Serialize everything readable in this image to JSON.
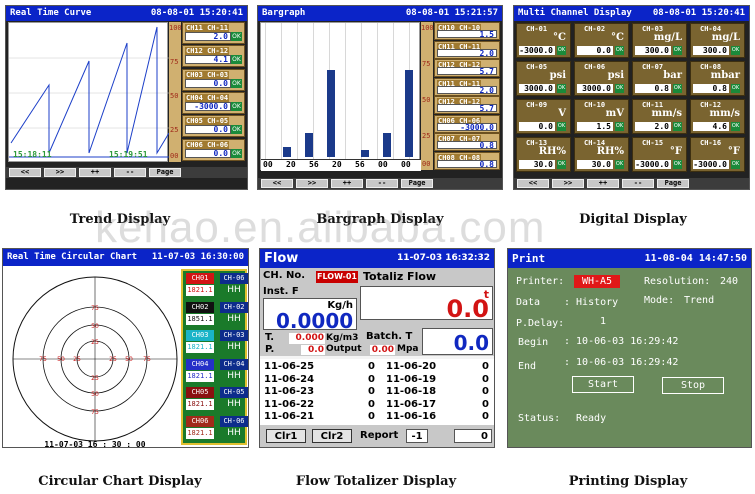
{
  "watermark": "kehao.en.alibaba.com",
  "colors": {
    "title_blue": "#0b24c8",
    "yellow_panel": "#d0b070",
    "green_bg": "#6a8a5c",
    "ok_green": "#1a8a3a"
  },
  "captions": [
    "Trend Display",
    "Bargraph Display",
    "Digital Display",
    "Circular Chart Display",
    "Flow Totalizer Display",
    "Printing Display"
  ],
  "buttons": [
    "<<",
    ">>",
    "++",
    "--",
    "Page"
  ],
  "trend": {
    "title": "Real Time Curve",
    "datetime": "08-08-01  15:20:41",
    "time_left": "15:18:11",
    "time_right": "15:19:51",
    "axis": [
      "100",
      "75",
      "50",
      "25",
      "00"
    ],
    "channels": [
      {
        "label": "CH11 CH-11",
        "value": "2.0",
        "ok": "OK"
      },
      {
        "label": "CH12 CH-12",
        "value": "4.1",
        "ok": "OK"
      },
      {
        "label": "CH03 CH-03",
        "value": "0.0",
        "ok": "OK"
      },
      {
        "label": "CH04 CH-04",
        "value": "-3000.0",
        "ok": "OK"
      },
      {
        "label": "CH05 CH-05",
        "value": "0.0",
        "ok": "OK"
      },
      {
        "label": "CH06 CH-06",
        "value": "0.0",
        "ok": "OK"
      }
    ]
  },
  "bargraph": {
    "title": "Bargraph",
    "datetime": "08-08-01  15:21:57",
    "axis": [
      "100",
      "75",
      "50",
      "25",
      "00"
    ],
    "ticks": [
      "00",
      "20",
      "56",
      "20",
      "56",
      "00",
      "00"
    ],
    "levels": [
      0.07,
      0.18,
      0.64,
      0.05,
      0.18,
      0.64
    ],
    "channels": [
      {
        "label": "CH10 CH-10",
        "value": "1.5"
      },
      {
        "label": "CH11 CH-11",
        "value": "2.0"
      },
      {
        "label": "CH12 CH-12",
        "value": "5.7"
      },
      {
        "label": "CH11 CH-11",
        "value": "2.0"
      },
      {
        "label": "CH12 CH-12",
        "value": "5.7"
      },
      {
        "label": "CH06 CH-06",
        "value": "-3000.0"
      },
      {
        "label": "CH07 CH-07",
        "value": "0.8"
      },
      {
        "label": "CH08 CH-08",
        "value": "0.8"
      }
    ]
  },
  "digital": {
    "title": "Multi Channel Display",
    "datetime": "08-08-01  15:20:41",
    "cells": [
      {
        "ch": "CH-01",
        "unit": "°C",
        "value": "-3000.0"
      },
      {
        "ch": "CH-02",
        "unit": "°C",
        "value": "0.0"
      },
      {
        "ch": "CH-03",
        "unit": "mg/L",
        "value": "300.0"
      },
      {
        "ch": "CH-04",
        "unit": "mg/L",
        "value": "300.0"
      },
      {
        "ch": "CH-05",
        "unit": "psi",
        "value": "3000.0"
      },
      {
        "ch": "CH-06",
        "unit": "psi",
        "value": "3000.0"
      },
      {
        "ch": "CH-07",
        "unit": "bar",
        "value": "0.8"
      },
      {
        "ch": "CH-08",
        "unit": "mbar",
        "value": "0.8"
      },
      {
        "ch": "CH-09",
        "unit": "V",
        "value": "0.0"
      },
      {
        "ch": "CH-10",
        "unit": "mV",
        "value": "1.5"
      },
      {
        "ch": "CH-11",
        "unit": "mm/s",
        "value": "2.0"
      },
      {
        "ch": "CH-12",
        "unit": "mm/s",
        "value": "4.6"
      },
      {
        "ch": "CH-13",
        "unit": "RH%",
        "value": "30.0"
      },
      {
        "ch": "CH-14",
        "unit": "RH%",
        "value": "30.0"
      },
      {
        "ch": "CH-15",
        "unit": "°F",
        "value": "-3000.0"
      },
      {
        "ch": "CH-16",
        "unit": "°F",
        "value": "-3000.0"
      }
    ]
  },
  "circular": {
    "title": "Real Time Circular Chart",
    "datetime": "11-07-03 16:30:00",
    "footer_time": "11-07-03 16 : 30 : 00",
    "ring_labels": [
      "75",
      "50",
      "25"
    ],
    "rows": [
      {
        "name": "CH01",
        "code": "CH-06",
        "value": "1821.1",
        "hh": "HH",
        "color": "#d21414"
      },
      {
        "name": "CH02",
        "code": "CH-02",
        "value": "1851.1",
        "hh": "HH",
        "color": "#111111"
      },
      {
        "name": "CH03",
        "code": "CH-03",
        "value": "1821.1",
        "hh": "HH",
        "color": "#19b4c8"
      },
      {
        "name": "CH04",
        "code": "CH-04",
        "value": "1821.1",
        "hh": "HH",
        "color": "#2430c8"
      },
      {
        "name": "CH05",
        "code": "CH-05",
        "value": "1821.1",
        "hh": "HH",
        "color": "#8a1010"
      },
      {
        "name": "CH06",
        "code": "CH-06",
        "value": "1821.1",
        "hh": "HH",
        "color": "#a02a1a"
      }
    ]
  },
  "flow": {
    "title": "Flow",
    "datetime": "11-07-03 16:32:32",
    "ch_no_label": "CH. No.",
    "ch_no_value": "FLOW-01",
    "totaliz_label": "Totaliz Flow",
    "totaliz_unit": "t",
    "totaliz_value": "0.0",
    "inst_label": "Inst. F",
    "inst_unit": "Kg/h",
    "inst_value": "0.0000",
    "t_label": "T.",
    "t_value": "0.000",
    "t_unit": "Kg/m3",
    "batch_label": "Batch. T",
    "batch_value": "0.0",
    "p_label": "P.",
    "p_value": "0.0",
    "output_label": "Output",
    "output_value": "0.00",
    "output_unit": "Mpa",
    "history": [
      {
        "d1": "11-06-25",
        "v1": "0",
        "d2": "11-06-20",
        "v2": "0"
      },
      {
        "d1": "11-06-24",
        "v1": "0",
        "d2": "11-06-19",
        "v2": "0"
      },
      {
        "d1": "11-06-23",
        "v1": "0",
        "d2": "11-06-18",
        "v2": "0"
      },
      {
        "d1": "11-06-22",
        "v1": "0",
        "d2": "11-06-17",
        "v2": "0"
      },
      {
        "d1": "11-06-21",
        "v1": "0",
        "d2": "11-06-16",
        "v2": "0"
      }
    ],
    "clr1": "Clr1",
    "clr2": "Clr2",
    "report_label": "Report",
    "report_value": "-1",
    "report_total": "0"
  },
  "print": {
    "title": "Print",
    "datetime": "11-08-04  14:47:50",
    "printer_label": "Printer:",
    "printer_value": "WH-A5",
    "resolution_label": "Resolution:",
    "resolution_value": "240",
    "data_label": "Data",
    "data_value": ": History",
    "mode_label": "Mode:",
    "mode_value": "Trend",
    "delay_label": "P.Delay:",
    "delay_value": "1",
    "begin_label": "Begin",
    "begin_value": ": 10-06-03 16:29:42",
    "end_label": "End",
    "end_value": ": 10-06-03 16:29:42",
    "start_label": "Start",
    "stop_label": "Stop",
    "status_label": "Status:",
    "status_value": "Ready"
  }
}
